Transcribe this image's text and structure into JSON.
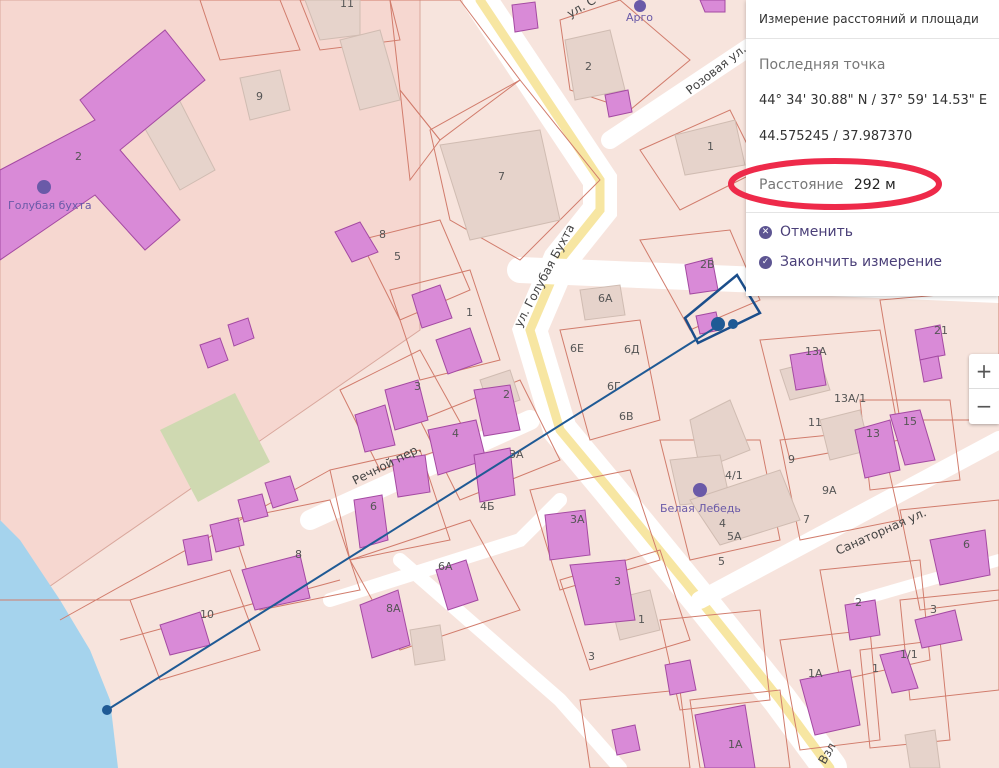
{
  "panel": {
    "title": "Измерение расстояний и площади",
    "last_point_label": "Последняя точка",
    "coords_dms": "44° 34' 30.88\" N / 37° 59' 14.53\" E",
    "coords_decimal": "44.575245 / 37.987370",
    "distance_label": "Расстояние",
    "distance_value": "292 м",
    "cancel_label": "Отменить",
    "finish_label": "Закончить измерение"
  },
  "zoom": {
    "in_label": "+",
    "out_label": "−"
  },
  "map": {
    "streets": {
      "golubaya_bukhta": "ул. Голубая Бухта",
      "rozovaya": "Розовая ул.",
      "rechnoy": "Речной пер.",
      "sanatornaya": "Санаторная ул.",
      "top_partial": "ул. С",
      "vzl_partial": "Взл"
    },
    "pois": {
      "argo": "Арго",
      "golubaya_bukhta": "Голубая бухта",
      "belaya_lebed": "Белая Лебедь"
    },
    "house_numbers": {
      "h11": "11",
      "h9": "9",
      "h2_big": "2",
      "h2_top": "2",
      "h1_top": "1",
      "h7": "7",
      "h8_a": "8",
      "h5_a": "5",
      "h1_mid": "1",
      "h3_a": "3",
      "h2_mid": "2",
      "h4": "4",
      "h3A": "3А",
      "h4B": "4Б",
      "h6_a": "6",
      "h8_b": "8",
      "h10": "10",
      "h8A": "8А",
      "h6A_low": "6А",
      "h3A_low": "3А",
      "h3_low": "3",
      "h1_low": "1",
      "h3_bot": "3",
      "h2B": "2В",
      "h6A": "6А",
      "h6E": "6Е",
      "h6D": "6Д",
      "h6G": "6Г",
      "h6V": "6В",
      "h13A": "13А",
      "h13A1": "13А/1",
      "h11_r": "11",
      "h13": "13",
      "h15": "15",
      "h9_r": "9",
      "h9A": "9А",
      "h41": "4/1",
      "h4_r": "4",
      "h5A": "5А",
      "h5": "5",
      "h7_r": "7",
      "h21": "21",
      "h6_r": "6",
      "h2_r": "2",
      "h3_r": "3",
      "h1A": "1А",
      "h1_r": "1",
      "h11_1": "1/1",
      "h1A_b": "1А"
    }
  }
}
